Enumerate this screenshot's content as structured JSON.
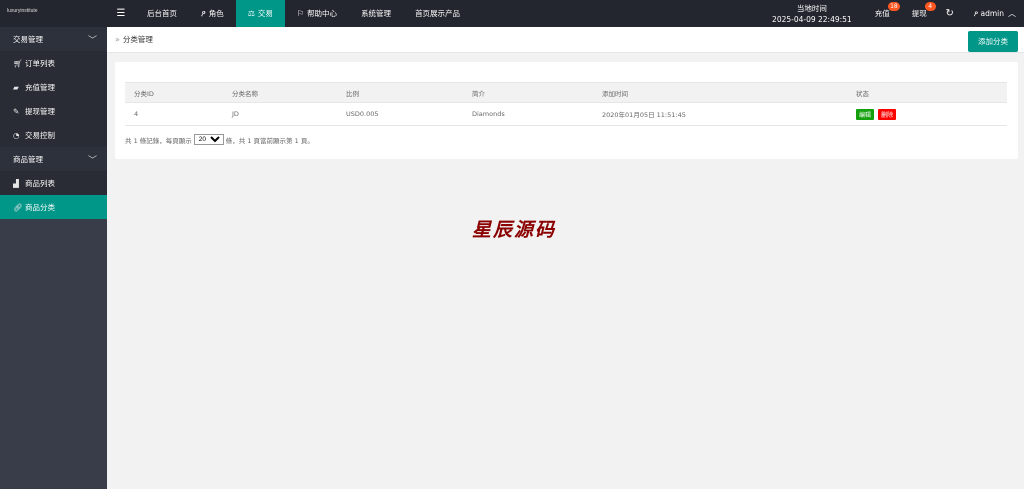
{
  "brand": {
    "name": "luxuryinstitute",
    "sup": "luxuryinstitute"
  },
  "nav": {
    "menu_icon": "hamburger-icon",
    "items": [
      {
        "label": "后台首页",
        "icon": ""
      },
      {
        "label": "角色",
        "icon": "user-icon"
      },
      {
        "label": "交易",
        "icon": "balance-icon",
        "active": true
      },
      {
        "label": "帮助中心",
        "icon": "flag-icon"
      },
      {
        "label": "系统管理",
        "icon": ""
      },
      {
        "label": "首页展示产品",
        "icon": ""
      }
    ]
  },
  "header_right": {
    "clock_label": "当地时间",
    "clock_value": "2025-04-09 22:49:51",
    "recharge": {
      "label": "充值",
      "badge": "18"
    },
    "withdraw": {
      "label": "提现",
      "badge": "4"
    },
    "refresh_icon": "refresh-icon",
    "user": "admin"
  },
  "sidebar": {
    "groups": [
      {
        "label": "交易管理",
        "items": [
          {
            "label": "订单列表",
            "icon": "cart-icon"
          },
          {
            "label": "充值管理",
            "icon": "chat-icon"
          },
          {
            "label": "提现管理",
            "icon": "tool-icon"
          },
          {
            "label": "交易控制",
            "icon": "gauge-icon"
          }
        ]
      },
      {
        "label": "商品管理",
        "items": [
          {
            "label": "商品列表",
            "icon": "truck-icon"
          },
          {
            "label": "商品分类",
            "icon": "link-icon",
            "active": true
          }
        ]
      }
    ]
  },
  "page": {
    "breadcrumb_sep": "»",
    "title": "分类管理",
    "add_button": "添加分类"
  },
  "table": {
    "headers": [
      "分类ID",
      "分类名称",
      "比例",
      "简介",
      "添加时间",
      "状态"
    ],
    "rows": [
      {
        "id": "4",
        "name": "JD",
        "ratio": "USD0.005",
        "intro": "Diamonds",
        "time": "2020年01月05日 11:51:45",
        "edit": "编辑",
        "delete": "删除"
      }
    ]
  },
  "pager": {
    "prefix": "共 1 條記錄，每頁顯示",
    "per_page": "20",
    "suffix": "條，共 1 頁當前顯示第 1 頁。"
  },
  "watermark": "星辰源码",
  "colors": {
    "accent": "#009688",
    "header": "#23262e",
    "sidebar": "#393d49",
    "badge": "#ff5722",
    "edit": "#14a10d",
    "delete": "#ff0000",
    "watermark": "#8b0000"
  }
}
